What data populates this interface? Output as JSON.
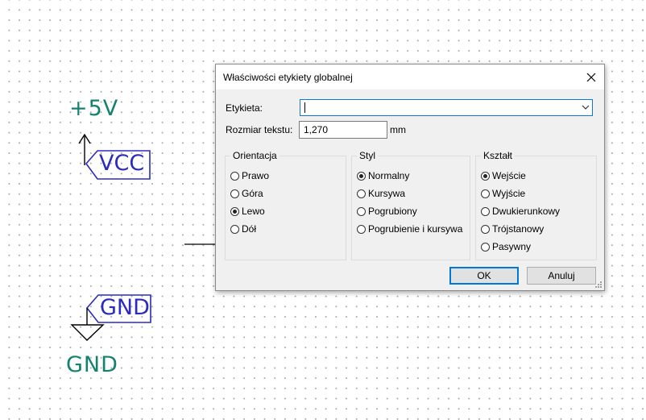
{
  "schematic": {
    "power_symbol_value": "+5V",
    "vcc_label": "VCC",
    "gnd_label": "GND",
    "gnd_symbol_value": "GND",
    "colors": {
      "power_text": "#15826e",
      "label": "#2b2bbd",
      "wire": "#000000"
    }
  },
  "dialog": {
    "title": "Właściwości etykiety globalnej",
    "close_icon": "close-icon",
    "label_field": {
      "label": "Etykieta:",
      "value": ""
    },
    "text_size": {
      "label": "Rozmiar tekstu:",
      "value": "1,270",
      "unit": "mm"
    },
    "orientation": {
      "title": "Orientacja",
      "options": [
        "Prawo",
        "Góra",
        "Lewo",
        "Dół"
      ],
      "selected": "Lewo"
    },
    "style": {
      "title": "Styl",
      "options": [
        "Normalny",
        "Kursywa",
        "Pogrubiony",
        "Pogrubienie i kursywa"
      ],
      "selected": "Normalny"
    },
    "shape": {
      "title": "Kształt",
      "options": [
        "Wejście",
        "Wyjście",
        "Dwukierunkowy",
        "Trójstanowy",
        "Pasywny"
      ],
      "selected": "Wejście"
    },
    "buttons": {
      "ok": "OK",
      "cancel": "Anuluj"
    },
    "accent_color": "#0078d7"
  }
}
